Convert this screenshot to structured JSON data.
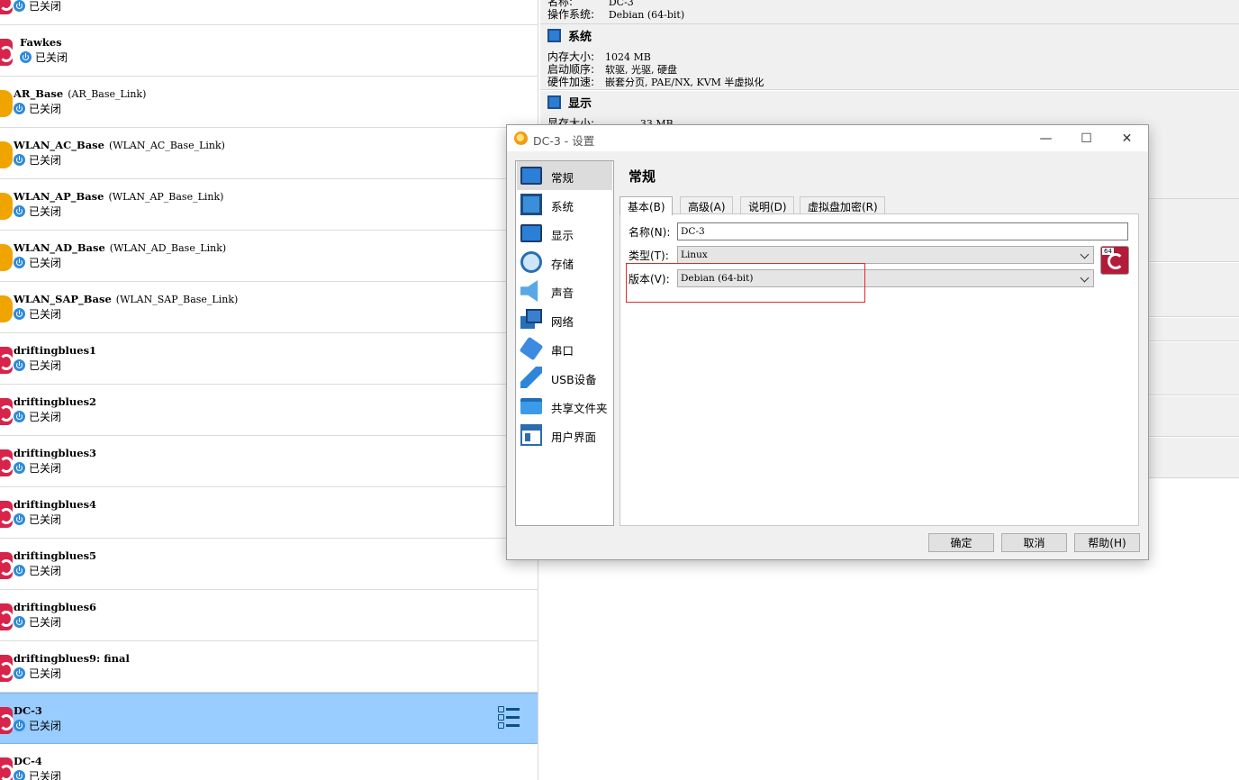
{
  "vm_list": {
    "partial_top_state": "已关闭",
    "rows": [
      {
        "name": "Fawkes",
        "group": "",
        "state": "已关闭",
        "os": "debian"
      },
      {
        "name": "AR_Base",
        "group": "(AR_Base_Link)",
        "state": "已关闭",
        "os": "generic"
      },
      {
        "name": "WLAN_AC_Base",
        "group": "(WLAN_AC_Base_Link)",
        "state": "已关闭",
        "os": "generic"
      },
      {
        "name": "WLAN_AP_Base",
        "group": "(WLAN_AP_Base_Link)",
        "state": "已关闭",
        "os": "generic"
      },
      {
        "name": "WLAN_AD_Base",
        "group": "(WLAN_AD_Base_Link)",
        "state": "已关闭",
        "os": "generic"
      },
      {
        "name": "WLAN_SAP_Base",
        "group": "(WLAN_SAP_Base_Link)",
        "state": "已关闭",
        "os": "generic"
      },
      {
        "name": "driftingblues1",
        "group": "",
        "state": "已关闭",
        "os": "debian"
      },
      {
        "name": "driftingblues2",
        "group": "",
        "state": "已关闭",
        "os": "debian"
      },
      {
        "name": "driftingblues3",
        "group": "",
        "state": "已关闭",
        "os": "debian"
      },
      {
        "name": "driftingblues4",
        "group": "",
        "state": "已关闭",
        "os": "debian"
      },
      {
        "name": "driftingblues5",
        "group": "",
        "state": "已关闭",
        "os": "debian"
      },
      {
        "name": "driftingblues6",
        "group": "",
        "state": "已关闭",
        "os": "debian"
      },
      {
        "name": "driftingblues9: final",
        "group": "",
        "state": "已关闭",
        "os": "debian"
      },
      {
        "name": "DC-3",
        "group": "",
        "state": "已关闭",
        "os": "debian",
        "selected": true
      },
      {
        "name": "DC-4",
        "group": "",
        "state": "已关闭",
        "os": "debian"
      }
    ]
  },
  "details": {
    "general_partial": {
      "name_key": "名称:",
      "name_value": "DC-3",
      "os_key": "操作系统:",
      "os_value": "Debian (64-bit)"
    },
    "system": {
      "title": "系统",
      "rows": [
        {
          "k": "内存大小:",
          "v": "1024 MB"
        },
        {
          "k": "启动顺序:",
          "v": "软驱, 光驱, 硬盘"
        },
        {
          "k": "硬件加速:",
          "v": "嵌套分页, PAE/NX, KVM 半虚拟化"
        }
      ]
    },
    "display": {
      "title": "显示",
      "partial_key": "显存大小:",
      "partial_value": "33 MB"
    }
  },
  "dialog": {
    "title": "DC-3 - 设置",
    "window_buttons": {
      "minimize": "—",
      "maximize": "☐",
      "close": "✕"
    },
    "categories": [
      {
        "label": "常规",
        "icon": "general-icon",
        "selected": true
      },
      {
        "label": "系统",
        "icon": "system-icon"
      },
      {
        "label": "显示",
        "icon": "display-icon"
      },
      {
        "label": "存储",
        "icon": "storage-icon"
      },
      {
        "label": "声音",
        "icon": "audio-icon"
      },
      {
        "label": "网络",
        "icon": "network-icon"
      },
      {
        "label": "串口",
        "icon": "serial-port-icon"
      },
      {
        "label": "USB设备",
        "icon": "usb-icon"
      },
      {
        "label": "共享文件夹",
        "icon": "shared-folder-icon"
      },
      {
        "label": "用户界面",
        "icon": "user-interface-icon"
      }
    ],
    "page_title": "常规",
    "tabs": [
      {
        "label": "基本(B)",
        "active": true
      },
      {
        "label": "高级(A)"
      },
      {
        "label": "说明(D)"
      },
      {
        "label": "虚拟盘加密(R)"
      }
    ],
    "form": {
      "name_label": "名称(N):",
      "name_value": "DC-3",
      "type_label": "类型(T):",
      "type_value": "Linux",
      "version_label": "版本(V):",
      "version_value": "Debian (64-bit)",
      "os_badge_text": "64"
    },
    "buttons": {
      "ok": "确定",
      "cancel": "取消",
      "help": "帮助(H)"
    }
  },
  "colors": {
    "selected_row": "#99ccff",
    "highlight_box": "#e02a2a",
    "accent": "#2e8ad8"
  }
}
